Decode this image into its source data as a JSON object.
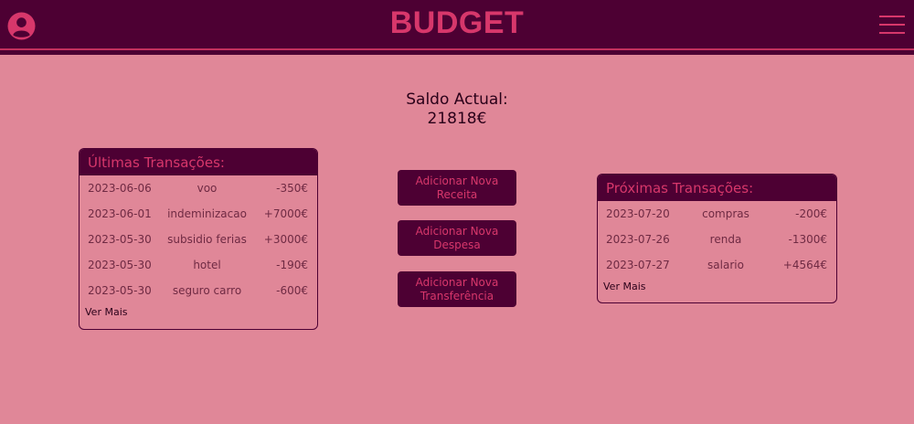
{
  "header": {
    "title": "BUDGET",
    "avatar_icon": "user-circle-icon",
    "menu_icon": "hamburger-menu-icon"
  },
  "balance": {
    "label": "Saldo Actual:",
    "value": "21818€"
  },
  "recent": {
    "title": "Últimas Transações:",
    "rows": [
      {
        "date": "2023-06-06",
        "desc": "voo",
        "amount": "-350€"
      },
      {
        "date": "2023-06-01",
        "desc": "indeminizacao",
        "amount": "+7000€"
      },
      {
        "date": "2023-05-30",
        "desc": "subsidio ferias",
        "amount": "+3000€"
      },
      {
        "date": "2023-05-30",
        "desc": "hotel",
        "amount": "-190€"
      },
      {
        "date": "2023-05-30",
        "desc": "seguro carro",
        "amount": "-600€"
      }
    ],
    "more": "Ver Mais"
  },
  "actions": {
    "income": "Adicionar Nova\nReceita",
    "expense": "Adicionar Nova\nDespesa",
    "transfer": "Adicionar Nova\nTransferência"
  },
  "upcoming": {
    "title": "Próximas Transações:",
    "rows": [
      {
        "date": "2023-07-20",
        "desc": "compras",
        "amount": "-200€"
      },
      {
        "date": "2023-07-26",
        "desc": "renda",
        "amount": "-1300€"
      },
      {
        "date": "2023-07-27",
        "desc": "salario",
        "amount": "+4564€"
      }
    ],
    "more": "Ver Mais"
  },
  "colors": {
    "background": "#e08798",
    "primary": "#4d0033",
    "accent": "#d7376b"
  }
}
